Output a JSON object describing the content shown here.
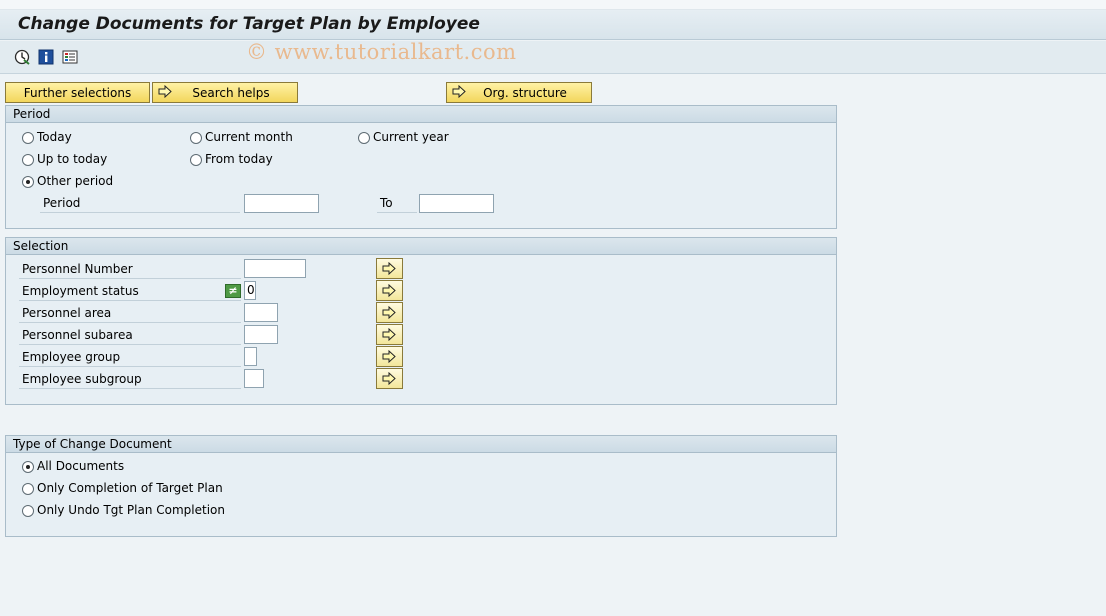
{
  "title": "Change Documents for Target Plan by Employee",
  "watermark": "© www.tutorialkart.com",
  "toolbar": {
    "icons": [
      "execute-icon",
      "info-icon",
      "variant-icon"
    ]
  },
  "buttons": {
    "further_selections": "Further selections",
    "search_helps": "Search helps",
    "org_structure": "Org. structure"
  },
  "period": {
    "header": "Period",
    "options": {
      "today": "Today",
      "current_month": "Current month",
      "current_year": "Current year",
      "up_to_today": "Up to today",
      "from_today": "From today",
      "other_period": "Other period"
    },
    "selected": "Other period",
    "period_label": "Period",
    "period_from": "",
    "to_label": "To",
    "period_to": ""
  },
  "selection": {
    "header": "Selection",
    "fields": {
      "personnel_number": {
        "label": "Personnel Number",
        "value": ""
      },
      "employment_status": {
        "label": "Employment status",
        "value": "0",
        "option": "≠"
      },
      "personnel_area": {
        "label": "Personnel area",
        "value": ""
      },
      "personnel_subarea": {
        "label": "Personnel subarea",
        "value": ""
      },
      "employee_group": {
        "label": "Employee group",
        "value": ""
      },
      "employee_subgroup": {
        "label": "Employee subgroup",
        "value": ""
      }
    }
  },
  "change_type": {
    "header": "Type of Change Document",
    "options": {
      "all": "All Documents",
      "completion": "Only Completion of Target Plan",
      "undo": "Only Undo Tgt Plan Completion"
    },
    "selected": "All Documents"
  },
  "colors": {
    "button_yellow": "#f2d65c",
    "group_bg": "#e7eff4",
    "page_bg": "#eef3f6",
    "exclude_green": "#4f9a45"
  }
}
